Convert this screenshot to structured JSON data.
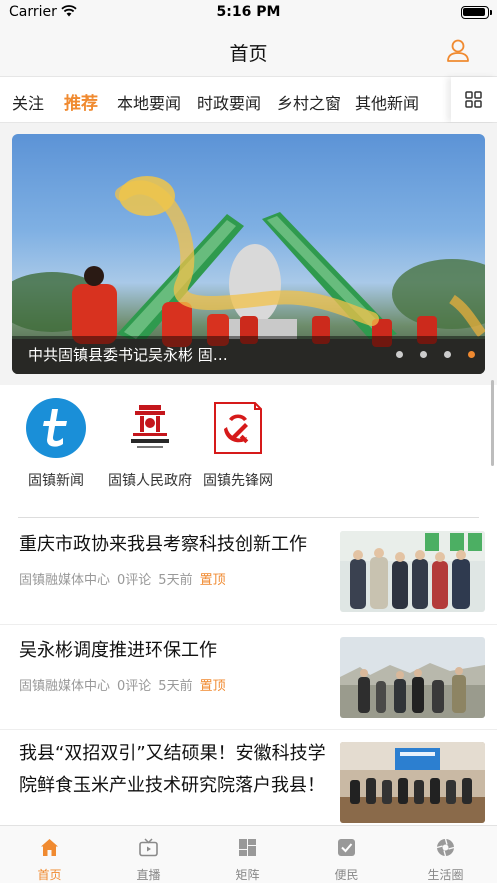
{
  "status": {
    "carrier": "Carrier",
    "time": "5:16 PM"
  },
  "nav": {
    "title": "首页",
    "user_icon": "user-icon"
  },
  "channels": [
    {
      "label": "关注",
      "active": false
    },
    {
      "label": "推荐",
      "active": true
    },
    {
      "label": "本地要闻",
      "active": false
    },
    {
      "label": "时政要闻",
      "active": false
    },
    {
      "label": "乡村之窗",
      "active": false
    },
    {
      "label": "其他新闻",
      "active": false
    }
  ],
  "banner": {
    "caption": "中共固镇县委书记吴永彬 固…",
    "slide_count": 4,
    "active_slide": 4
  },
  "shortcuts": [
    {
      "label": "固镇新闻",
      "icon": "guzhen-news-logo-icon"
    },
    {
      "label": "固镇人民政府",
      "icon": "government-emblem-icon"
    },
    {
      "label": "固镇先锋网",
      "icon": "party-emblem-icon"
    }
  ],
  "news": [
    {
      "title": "重庆市政协来我县考察科技创新工作",
      "source": "固镇融媒体中心",
      "comments": "0评论",
      "time": "5天前",
      "tag": "置顶"
    },
    {
      "title": "吴永彬调度推进环保工作",
      "source": "固镇融媒体中心",
      "comments": "0评论",
      "time": "5天前",
      "tag": "置顶"
    },
    {
      "title": "我县“双招双引”又结硕果！安徽科技学院鲜食玉米产业技术研究院落户我县！",
      "source": "",
      "comments": "",
      "time": "",
      "tag": ""
    }
  ],
  "tabbar": [
    {
      "label": "首页",
      "icon": "home-icon",
      "active": true
    },
    {
      "label": "直播",
      "icon": "tv-icon",
      "active": false
    },
    {
      "label": "矩阵",
      "icon": "matrix-icon",
      "active": false
    },
    {
      "label": "便民",
      "icon": "checkbox-icon",
      "active": false
    },
    {
      "label": "生活圈",
      "icon": "aperture-icon",
      "active": false
    }
  ],
  "colors": {
    "accent": "#f08a30",
    "inactive": "#888888"
  }
}
